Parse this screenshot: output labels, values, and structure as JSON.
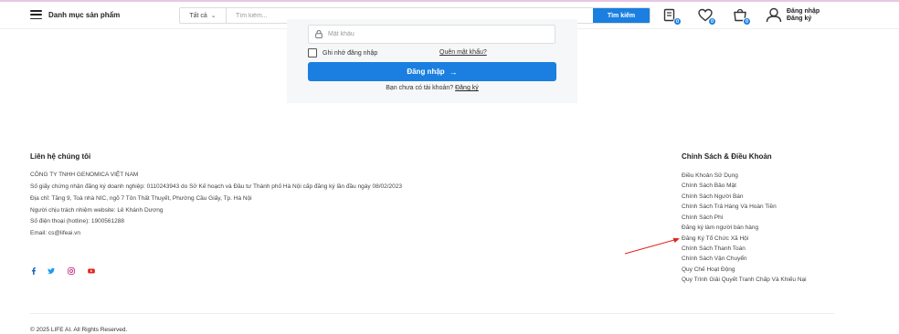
{
  "header": {
    "menu_label": "Danh mục sản phẩm",
    "search": {
      "category": "Tất cả",
      "placeholder": "Tìm kiếm...",
      "button": "Tìm kiếm"
    },
    "badges": {
      "compare": "0",
      "wishlist": "0",
      "cart": "0"
    },
    "account": {
      "login": "Đăng nhập",
      "register": "Đăng ký"
    },
    "icons": [
      "menu-icon",
      "chevron-down-icon",
      "compare-icon",
      "heart-icon",
      "cart-icon",
      "user-icon"
    ]
  },
  "login_form": {
    "password_placeholder": "Mật khẩu",
    "remember_label": "Ghi nhớ đăng nhập",
    "forgot_link": "Quên mật khẩu?",
    "submit_label": "Đăng nhập",
    "signup_prompt": "Bạn chưa có tài khoản?",
    "signup_link": "Đăng ký",
    "icons": [
      "lock-icon",
      "arrow-right-icon"
    ]
  },
  "footer": {
    "contact": {
      "title": "Liên hệ chúng tôi",
      "lines": [
        "CÔNG TY TNHH GENOMICA VIỆT NAM",
        "Số giấy chứng nhận đăng ký doanh nghiệp: 0110243943 do Sở Kế hoạch và Đầu tư Thành phố Hà Nội cấp đăng ký lần đầu ngày 08/02/2023",
        "Địa chỉ: Tầng 9, Toà nhà NIC, ngõ 7 Tôn Thất Thuyết, Phường Cầu Giấy, Tp. Hà Nội",
        "Người chịu trách nhiệm website: Lê Khánh Dương",
        "Số điện thoại (hotline): 1900561288",
        "Email: cs@lifeai.vn"
      ]
    },
    "social": [
      "facebook-icon",
      "twitter-icon",
      "instagram-icon",
      "youtube-icon"
    ],
    "policies": {
      "title": "Chính Sách & Điều Khoản",
      "links": [
        "Điều Khoản Sử Dụng",
        "Chính Sách Bảo Mật",
        "Chính Sách Người Bán",
        "Chính Sách Trả Hàng Và Hoàn Tiền",
        "Chính Sách Phí",
        "Đăng ký làm người bán hàng",
        "Đăng Ký Tổ Chức Xã Hội",
        "Chính Sách Thanh Toán",
        "Chính Sách Vận Chuyển",
        "Quy Chế Hoạt Động",
        "Quy Trình Giải Quyết Tranh Chấp Và Khiếu Nại"
      ]
    },
    "copyright": "© 2025 LIFE AI. All Rights Reserved."
  },
  "colors": {
    "primary": "#1a7fe0",
    "annotation_arrow": "#e0241f",
    "card_background": "#f6f7f8",
    "top_accent": "#e9c6e3"
  }
}
